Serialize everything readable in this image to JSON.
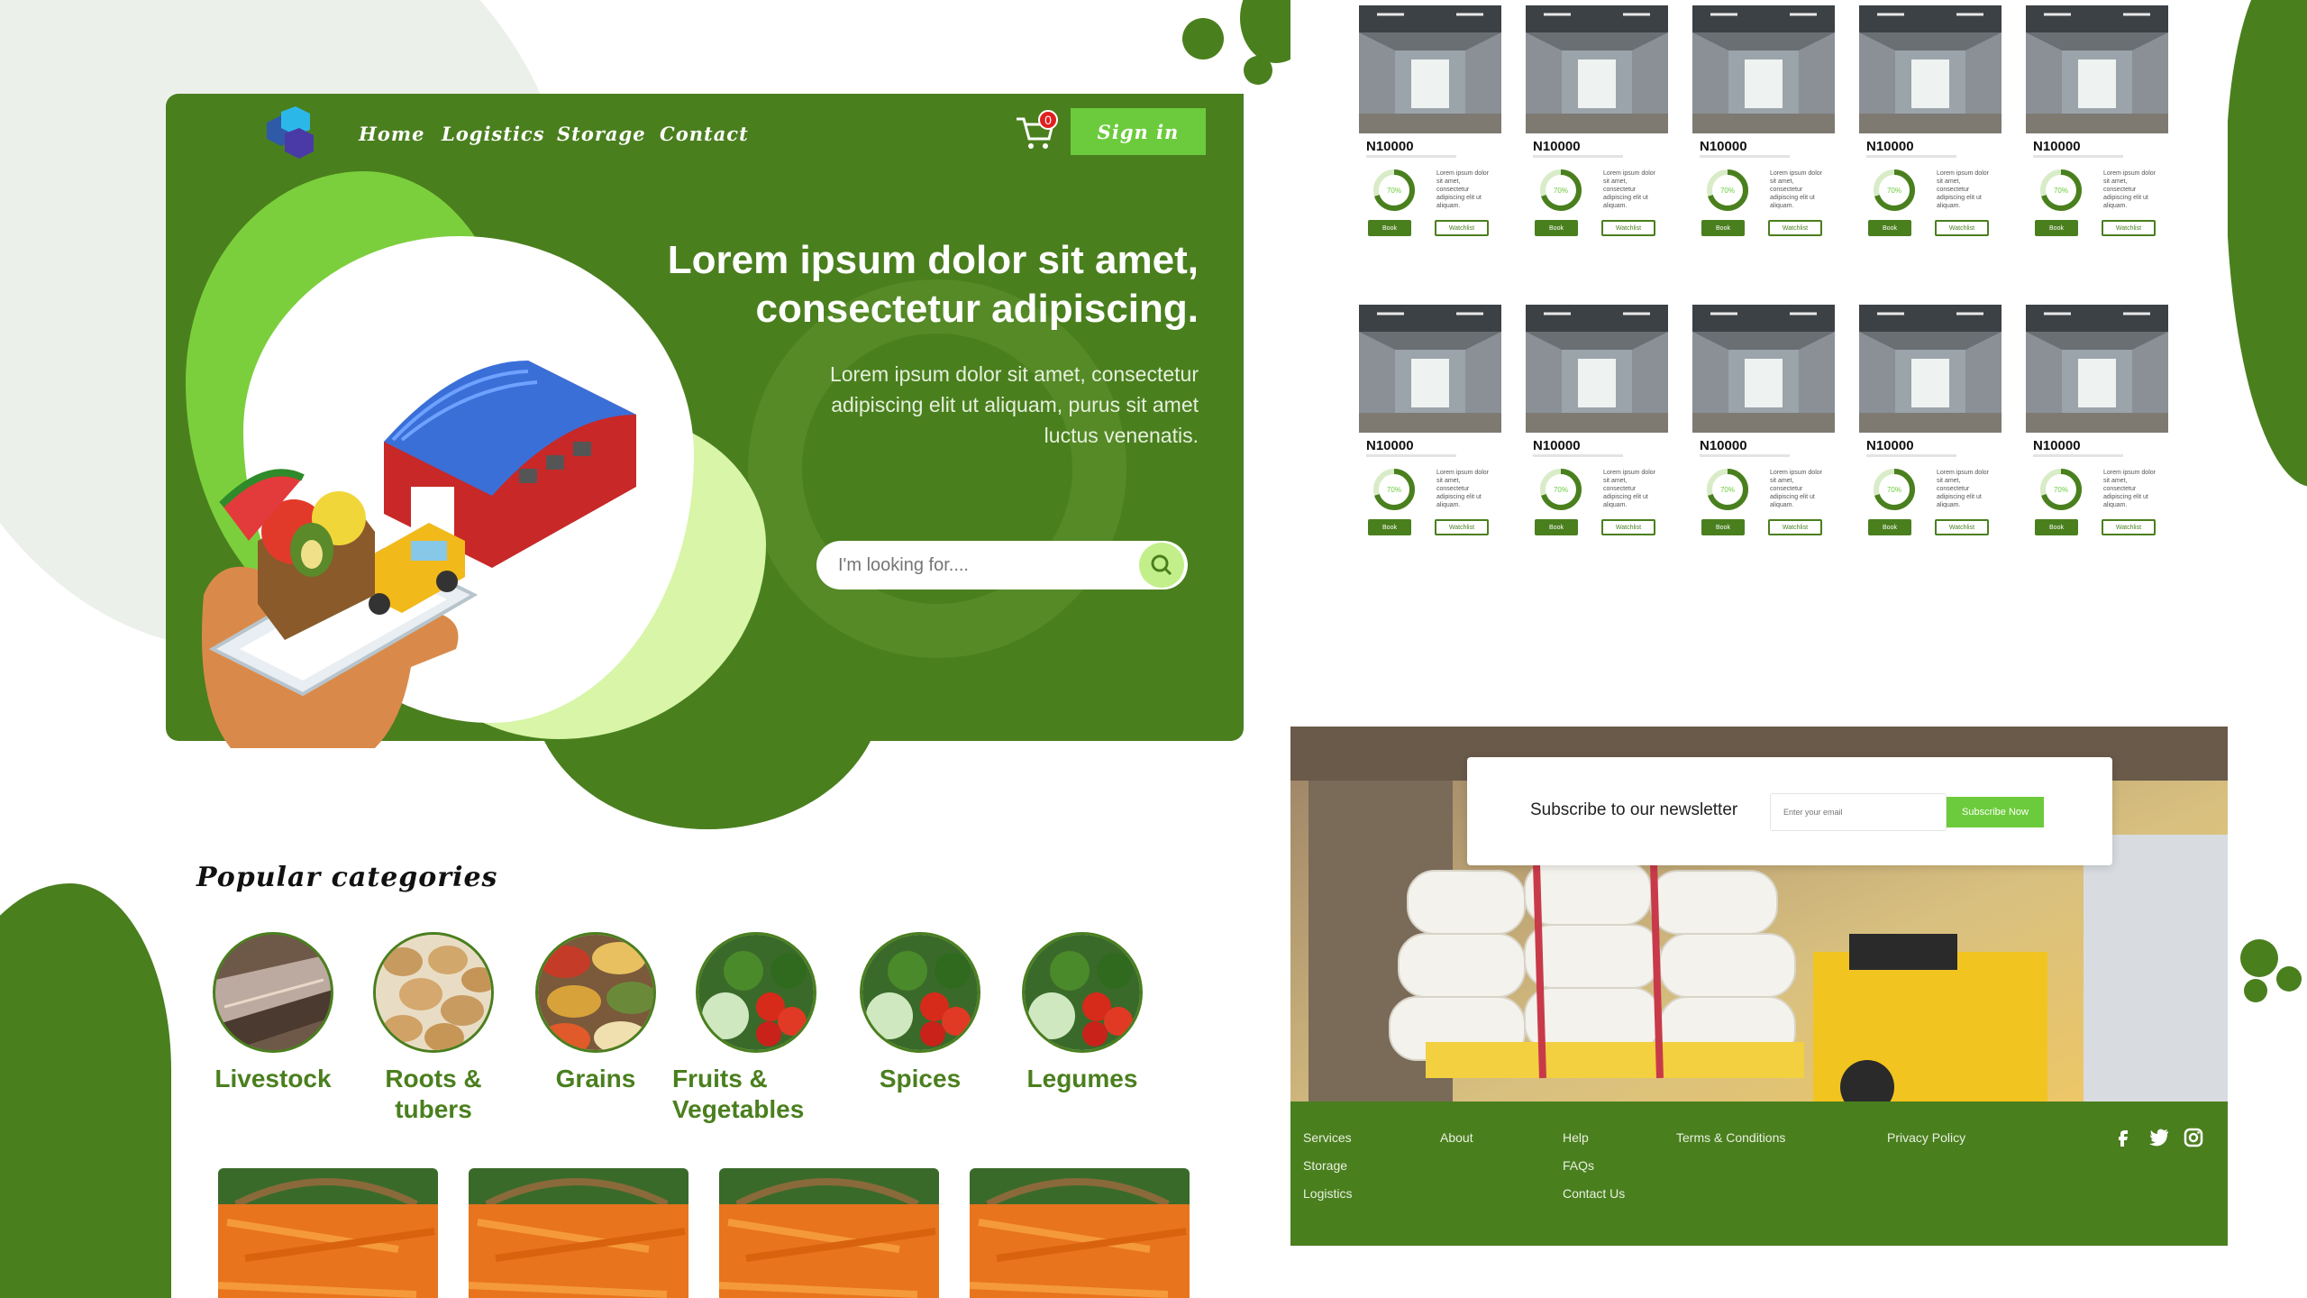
{
  "nav": {
    "links": [
      "Home",
      "Logistics",
      "Storage",
      "Contact"
    ],
    "cart_count": "0",
    "signin_label": "Sign in"
  },
  "hero": {
    "title_line1": "Lorem ipsum dolor sit amet,",
    "title_line2": "consectetur adipiscing.",
    "subtitle_line1": "Lorem ipsum dolor sit amet, consectetur",
    "subtitle_line2": "adipiscing elit ut aliquam, purus sit amet",
    "subtitle_line3": "luctus venenatis.",
    "search_placeholder": "I'm looking for...."
  },
  "categories": {
    "title": "Popular categories",
    "items": [
      {
        "line1": "Livestock",
        "line2": ""
      },
      {
        "line1": "Roots &",
        "line2": "tubers"
      },
      {
        "line1": "Grains",
        "line2": ""
      },
      {
        "line1": "Fruits &",
        "line2": "Vegetables"
      },
      {
        "line1": "Spices",
        "line2": ""
      },
      {
        "line1": "Legumes",
        "line2": ""
      }
    ]
  },
  "listing": {
    "price": "N10000",
    "ring_percent": 70,
    "ring_label": "70%",
    "description": "Lorem ipsum dolor sit amet, consectetur adipiscing elit ut aliquam.",
    "book_label": "Book",
    "watch_label": "Watchlist"
  },
  "newsletter": {
    "label": "Subscribe to our newsletter",
    "placeholder": "Enter your email",
    "button": "Subscribe Now"
  },
  "footer": {
    "col1": [
      "Services",
      "Storage",
      "Logistics"
    ],
    "col2": [
      "About"
    ],
    "col3": [
      "Help",
      "FAQs",
      "Contact Us"
    ],
    "col4": [
      "Terms & Conditions"
    ],
    "col5": [
      "Privacy Policy"
    ],
    "social": [
      "facebook-icon",
      "twitter-icon",
      "instagram-icon"
    ]
  },
  "colors": {
    "brand_green": "#4a7f1e",
    "accent_green": "#6ccb3c",
    "pale_green": "#d8f5a8"
  }
}
